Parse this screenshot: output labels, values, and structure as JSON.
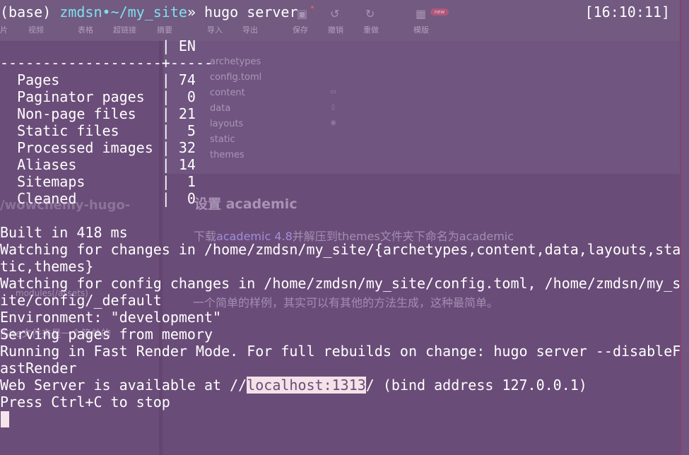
{
  "background_editor": {
    "toolbar": {
      "buttons": [
        "片",
        "视频",
        "表格",
        "超链接",
        "摘要",
        "导入",
        "导出",
        "保存",
        "撤销",
        "重做",
        "模版"
      ],
      "badge": "new"
    },
    "directory_items": [
      "archetypes",
      "config.toml",
      "content",
      "data",
      "layouts",
      "static",
      "themes"
    ],
    "left_heading": "/wowchemy-hugo-",
    "left_snippets": [
      "modules(/assets)",
      "iSite文件夹是一个简单的"
    ],
    "doc": {
      "heading": "设置 academic",
      "line1_prefix": "下载",
      "line1_link": "academic 4.8",
      "line1_suffix": "并解压到themes文件夹下命名为academic",
      "line2": "一个简单的样例，其实可以有其他的方法生成，这种最简单。"
    }
  },
  "terminal": {
    "prompt": {
      "env": "(base)",
      "user": "zmdsn",
      "separator": "•",
      "path": "~/my_site",
      "arrow": "»",
      "command": "hugo server"
    },
    "clock": "[16:10:11]",
    "table_header": "                   | EN",
    "table_rule": "-------------------+-----",
    "stats": [
      {
        "label": "  Pages            ",
        "value": " 74"
      },
      {
        "label": "  Paginator pages  ",
        "value": "  0"
      },
      {
        "label": "  Non-page files   ",
        "value": " 21"
      },
      {
        "label": "  Static files     ",
        "value": "  5"
      },
      {
        "label": "  Processed images ",
        "value": " 32"
      },
      {
        "label": "  Aliases          ",
        "value": " 14"
      },
      {
        "label": "  Sitemaps         ",
        "value": "  1"
      },
      {
        "label": "  Cleaned          ",
        "value": "  0"
      }
    ],
    "built": "Built in 418 ms",
    "watch1a": "Watching for changes in /home/zmdsn/my_site/{archetypes,content,data,layouts,sta",
    "watch1b": "tic,themes}",
    "watch2a": "Watching for config changes in /home/zmdsn/my_site/config.toml, /home/zmdsn/my_s",
    "watch2b": "ite/config/_default",
    "environment": "Environment: \"development\"",
    "serving": "Serving pages from memory",
    "fastrender_a": "Running in Fast Render Mode. For full rebuilds on change: hugo server --disableF",
    "fastrender_b": "astRender",
    "server_prefix": "Web Server is available at //",
    "server_host": "localhost:1313",
    "server_suffix": "/ (bind address 127.0.0.1)",
    "stop": "Press Ctrl+C to stop"
  },
  "colors": {
    "terminal_bg": "#6a4c78",
    "prompt_cyan": "#7ee0f0",
    "selection_bg": "#f4e2e8"
  }
}
